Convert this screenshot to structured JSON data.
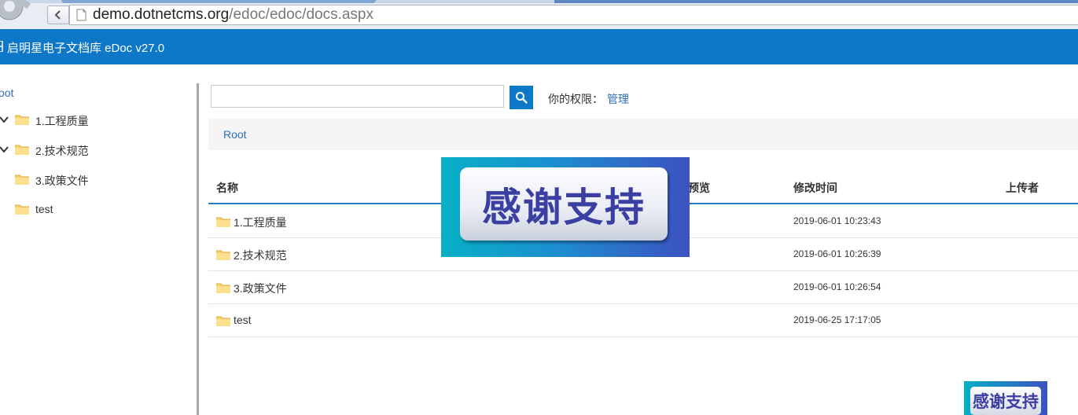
{
  "browser": {
    "url_host": "demo.dotnetcms.org",
    "url_path": "/edoc/edoc/docs.aspx"
  },
  "app": {
    "title": "启明星电子文档库 eDoc v27.0",
    "brand_color": "#0d78c8"
  },
  "sidebar": {
    "root_label": "oot",
    "items": [
      {
        "label": "1.工程质量",
        "expandable": true
      },
      {
        "label": "2.技术规范",
        "expandable": true
      },
      {
        "label": "3.政策文件",
        "expandable": false
      },
      {
        "label": "test",
        "expandable": false
      }
    ]
  },
  "toolbar": {
    "search_placeholder": "",
    "perm_label": "你的权限：",
    "perm_value": "管理"
  },
  "breadcrumb": {
    "items": [
      "Root"
    ]
  },
  "table": {
    "headers": {
      "name": "名称",
      "preview": "预览",
      "modified": "修改时间",
      "uploader": "上传者"
    },
    "rows": [
      {
        "name": "1.工程质量",
        "modified": "2019-06-01 10:23:43"
      },
      {
        "name": "2.技术规范",
        "modified": "2019-06-01 10:26:39"
      },
      {
        "name": "3.政策文件",
        "modified": "2019-06-01 10:26:54"
      },
      {
        "name": "test",
        "modified": "2019-06-25 17:17:05"
      }
    ]
  },
  "overlay": {
    "thanks_big": "感谢支持",
    "thanks_small": "感谢支持"
  }
}
